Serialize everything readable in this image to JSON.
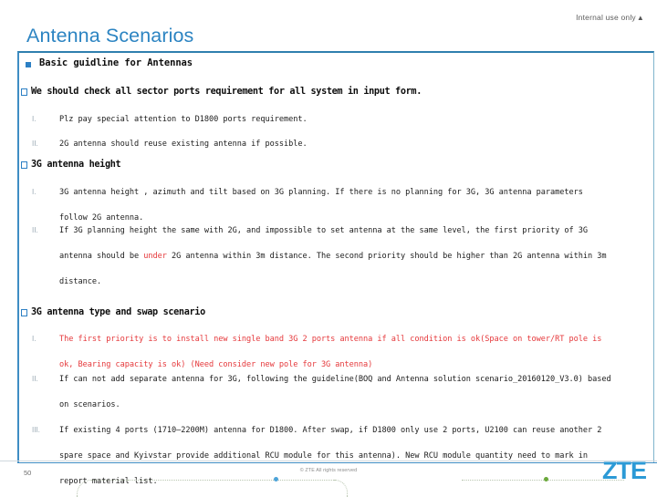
{
  "header": {
    "title": "Antenna Scenarios",
    "internal_use": "Internal use only",
    "internal_use_marker": "▲"
  },
  "content": {
    "section_title": "Basic guidline for Antennas",
    "blocks": [
      {
        "heading": "We should check all sector ports requirement for all system in input form.",
        "items": [
          {
            "num": "I.",
            "lines": [
              "Plz pay special attention to D1800 ports requirement."
            ],
            "color": "black"
          },
          {
            "num": "II.",
            "lines": [
              "2G antenna should reuse existing antenna if possible."
            ],
            "color": "black"
          }
        ]
      },
      {
        "heading": "3G antenna height",
        "items": [
          {
            "num": "I.",
            "lines": [
              "3G antenna height , azimuth and tilt based on 3G planning. If there is no planning for 3G,  3G  antenna parameters",
              "follow 2G antenna."
            ],
            "color": "black"
          },
          {
            "num": "II.",
            "lines": [
              "If 3G planning height the same with 2G, and impossible to set antenna at the same level, the first priority of  3G",
              "antenna should be §under§ 2G antenna within 3m distance. The second priority should be higher than 2G antenna within 3m",
              "distance."
            ],
            "color": "black"
          }
        ]
      },
      {
        "heading": "3G antenna type and swap scenario",
        "items": [
          {
            "num": "I.",
            "lines": [
              "The first priority is to install new single band 3G 2 ports antenna if all condition is ok(Space on tower/RT pole is",
              "ok, Bearing capacity is ok) (Need consider new pole for 3G antenna)"
            ],
            "color": "red"
          },
          {
            "num": "II.",
            "lines": [
              "If can not  add separate antenna for 3G, following the guideline(BOQ and Antenna solution scenario_20160120_V3.0) based",
              "on scenarios."
            ],
            "color": "black"
          },
          {
            "num": "III.",
            "lines": [
              "If existing 4 ports (1710–2200M) antenna for D1800. After swap, if D1800 only use 2 ports, U2100 can reuse another 2",
              "spare space and Kyivstar provide additional RCU module for this antenna). New RCU module quantity need to mark in",
              "report material list."
            ],
            "color": "black"
          }
        ]
      }
    ]
  },
  "footer": {
    "page_number": "50",
    "copyright": "© ZTE All rights reserved",
    "logo": "ZTE"
  },
  "colors": {
    "title_blue": "#2c84c2",
    "accent_blue": "#2c7fc4",
    "red": "#e5383b",
    "logo_blue": "#2c9ad6",
    "green_dot": "#6aa83b"
  }
}
